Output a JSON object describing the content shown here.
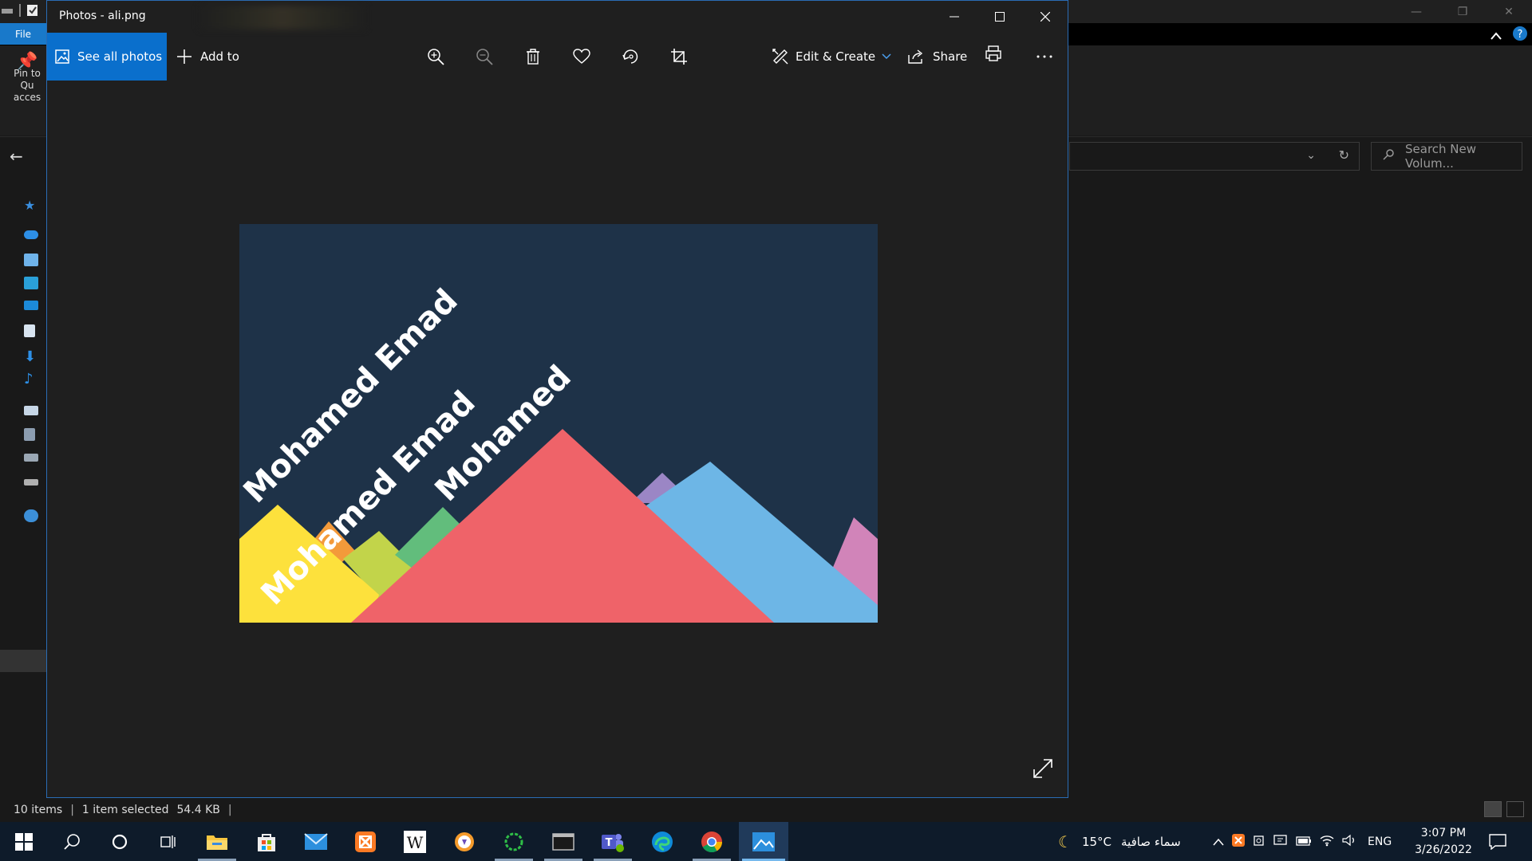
{
  "explorer": {
    "file_tab": "File",
    "pin_label": "Pin to Qu acces",
    "search_placeholder": "Search New Volum...",
    "status": {
      "items": "10 items",
      "selected": "1 item selected",
      "size": "54.4 KB"
    }
  },
  "photos": {
    "title": "Photos - ali.png",
    "toolbar": {
      "see_all": "See all photos",
      "add_to": "Add to",
      "edit_create": "Edit & Create",
      "share": "Share"
    },
    "image": {
      "background": "#1e3248",
      "texts": [
        "Mohamed Emad",
        "Mohamed Emad",
        "Mohamed"
      ],
      "colors": {
        "yellow": "#fde13c",
        "orange": "#f39a3a",
        "lime": "#c2d44a",
        "green": "#62bd7c",
        "red": "#ef6369",
        "purple": "#9b86c5",
        "blue": "#6db6e6",
        "pink": "#d184b9"
      }
    }
  },
  "taskbar": {
    "weather_temp": "15°C",
    "weather_text": "سماء صافية",
    "language": "ENG",
    "time": "3:07 PM",
    "date": "3/26/2022"
  }
}
